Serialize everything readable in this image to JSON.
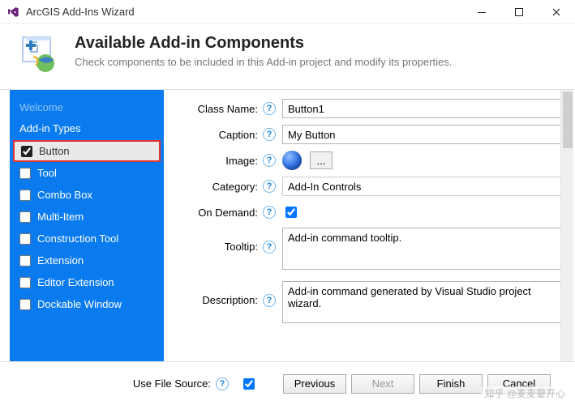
{
  "window": {
    "title": "ArcGIS Add-Ins Wizard"
  },
  "header": {
    "title": "Available Add-in Components",
    "subtitle": "Check components to be included in this Add-in project and modify its properties."
  },
  "sidebar": {
    "tab": "Welcome",
    "section": "Add-in Types",
    "items": [
      {
        "label": "Button",
        "checked": true,
        "highlighted": true
      },
      {
        "label": "Tool",
        "checked": false,
        "highlighted": false
      },
      {
        "label": "Combo Box",
        "checked": false,
        "highlighted": false
      },
      {
        "label": "Multi-Item",
        "checked": false,
        "highlighted": false
      },
      {
        "label": "Construction Tool",
        "checked": false,
        "highlighted": false
      },
      {
        "label": "Extension",
        "checked": false,
        "highlighted": false
      },
      {
        "label": "Editor Extension",
        "checked": false,
        "highlighted": false
      },
      {
        "label": "Dockable Window",
        "checked": false,
        "highlighted": false
      }
    ]
  },
  "form": {
    "class_name_lab": "Class Name:",
    "class_name": "Button1",
    "caption_lab": "Caption:",
    "caption": "My Button",
    "image_lab": "Image:",
    "browse": "...",
    "category_lab": "Category:",
    "category": "Add-In Controls",
    "ondemand_lab": "On Demand:",
    "ondemand": true,
    "tooltip_lab": "Tooltip:",
    "tooltip": "Add-in command tooltip.",
    "description_lab": "Description:",
    "description": "Add-in command generated by Visual Studio project wizard.",
    "use_file_source_lab": "Use File Source:",
    "use_file_source": true
  },
  "footer": {
    "previous": "Previous",
    "next": "Next",
    "finish": "Finish",
    "cancel": "Cancel"
  },
  "watermark": "知乎 @麦麦要开心"
}
